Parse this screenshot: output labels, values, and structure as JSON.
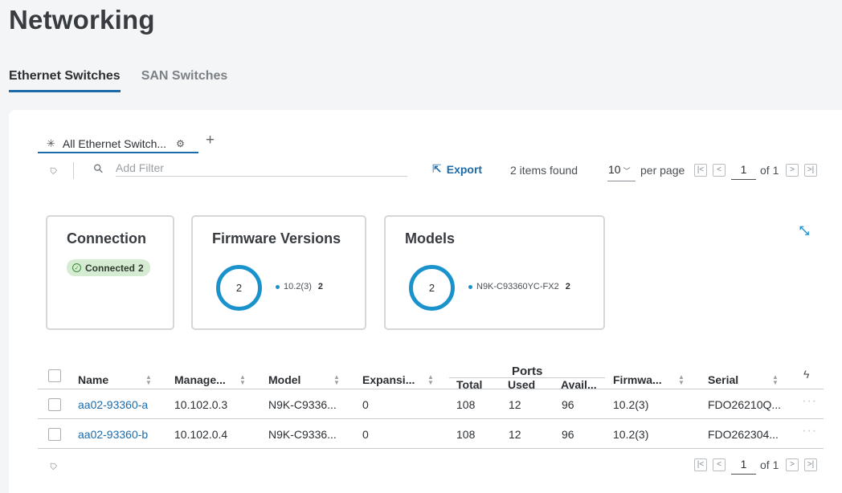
{
  "page_title": "Networking",
  "top_tabs": [
    {
      "label": "Ethernet Switches",
      "active": true
    },
    {
      "label": "SAN Switches",
      "active": false
    }
  ],
  "view_tab": {
    "label": "All Ethernet Switch...",
    "add_label": "+"
  },
  "filter": {
    "placeholder": "Add Filter"
  },
  "export_label": "Export",
  "items_found": "2 items found",
  "pagination": {
    "per_page_value": "10",
    "per_page_label": "per page",
    "page": "1",
    "of_label": "of 1"
  },
  "widgets": {
    "connection": {
      "title": "Connection",
      "badge_label": "Connected",
      "badge_count": "2"
    },
    "firmware": {
      "title": "Firmware Versions",
      "total": "2",
      "legend_label": "10.2(3)",
      "legend_value": "2"
    },
    "models": {
      "title": "Models",
      "total": "2",
      "legend_label": "N9K-C93360YC-FX2",
      "legend_value": "2"
    }
  },
  "table": {
    "columns": {
      "name": "Name",
      "management": "Manage...",
      "model": "Model",
      "expansion": "Expansi...",
      "ports": "Ports",
      "total": "Total",
      "used": "Used",
      "available": "Avail...",
      "firmware": "Firmwa...",
      "serial": "Serial"
    },
    "rows": [
      {
        "name": "aa02-93360-a",
        "management": "10.102.0.3",
        "model": "N9K-C9336...",
        "expansion": "0",
        "total": "108",
        "used": "12",
        "available": "96",
        "firmware": "10.2(3)",
        "serial": "FDO26210Q..."
      },
      {
        "name": "aa02-93360-b",
        "management": "10.102.0.4",
        "model": "N9K-C9336...",
        "expansion": "0",
        "total": "108",
        "used": "12",
        "available": "96",
        "firmware": "10.2(3)",
        "serial": "FDO262304..."
      }
    ]
  },
  "colors": {
    "accent": "#1d6aa8",
    "donut": "#1a93cd",
    "connected_bg": "#d6ecd2"
  },
  "icons": [
    "tag-icon",
    "search-icon",
    "export-icon",
    "gear-icon",
    "collapse-icon",
    "bolt-icon",
    "more-icon",
    "check-circle-icon"
  ]
}
